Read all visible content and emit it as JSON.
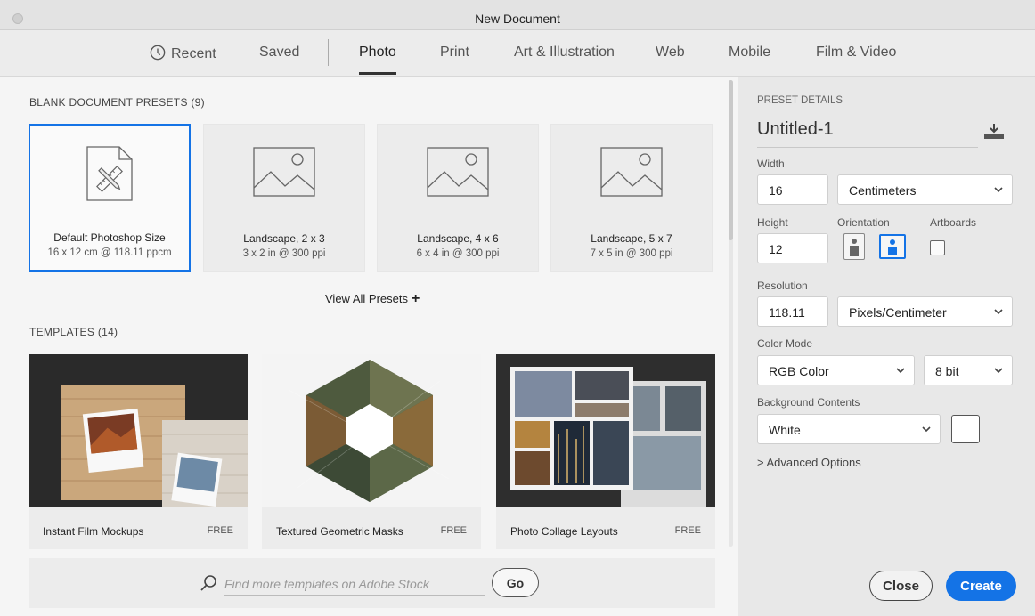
{
  "window": {
    "title": "New Document"
  },
  "tabs": [
    {
      "label": "Recent",
      "icon": "clock-icon"
    },
    {
      "label": "Saved"
    },
    {
      "label": "Photo",
      "active": true
    },
    {
      "label": "Print"
    },
    {
      "label": "Art & Illustration"
    },
    {
      "label": "Web"
    },
    {
      "label": "Mobile"
    },
    {
      "label": "Film & Video"
    }
  ],
  "presets": {
    "heading": "BLANK DOCUMENT PRESETS",
    "count": "(9)",
    "items": [
      {
        "name": "Default Photoshop Size",
        "size": "16 x 12 cm @ 118.11 ppcm",
        "icon": "document-ruler-icon",
        "selected": true
      },
      {
        "name": "Landscape, 2 x 3",
        "size": "3 x 2 in @ 300 ppi",
        "icon": "image-placeholder-icon"
      },
      {
        "name": "Landscape, 4 x 6",
        "size": "6 x 4 in @ 300 ppi",
        "icon": "image-placeholder-icon"
      },
      {
        "name": "Landscape, 5 x 7",
        "size": "7 x 5 in @ 300 ppi",
        "icon": "image-placeholder-icon"
      }
    ],
    "view_all": "View All Presets",
    "view_all_icon": "plus-icon"
  },
  "templates": {
    "heading": "TEMPLATES",
    "count": "(14)",
    "items": [
      {
        "name": "Instant Film Mockups",
        "badge": "FREE"
      },
      {
        "name": "Textured Geometric Masks",
        "badge": "FREE"
      },
      {
        "name": "Photo Collage Layouts",
        "badge": "FREE"
      }
    ]
  },
  "search": {
    "placeholder": "Find more templates on Adobe Stock",
    "value": "",
    "go_label": "Go",
    "icon": "search-icon"
  },
  "details": {
    "heading": "PRESET DETAILS",
    "name": "Untitled-1",
    "save_icon": "save-preset-icon",
    "width_label": "Width",
    "width_value": "16",
    "width_unit": "Centimeters",
    "height_label": "Height",
    "height_value": "12",
    "orientation_label": "Orientation",
    "orientation_selected": "landscape",
    "artboards_label": "Artboards",
    "artboards_checked": false,
    "resolution_label": "Resolution",
    "resolution_value": "118.11",
    "resolution_unit": "Pixels/Centimeter",
    "color_mode_label": "Color Mode",
    "color_mode": "RGB Color",
    "bit_depth": "8 bit",
    "background_label": "Background Contents",
    "background": "White",
    "background_swatch": "#ffffff",
    "advanced": "Advanced Options",
    "close_label": "Close",
    "create_label": "Create"
  },
  "colors": {
    "accent": "#1473e6"
  }
}
